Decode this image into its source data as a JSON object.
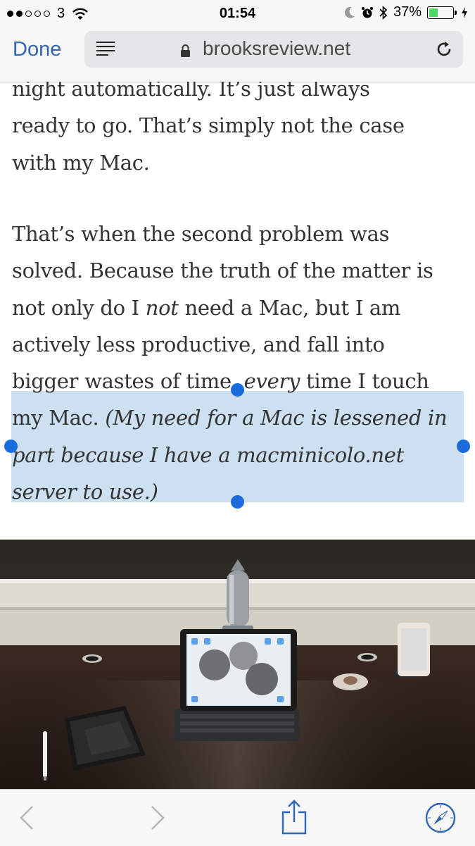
{
  "status_bar": {
    "carrier": "3",
    "time": "01:54",
    "battery": "37%",
    "battery_level": 0.37,
    "signal_bars_filled": 2,
    "signal_bars_total": 5,
    "icons": [
      "wifi-icon",
      "moon-icon",
      "alarm-icon",
      "bluetooth-icon",
      "battery-icon",
      "charging-icon"
    ]
  },
  "nav": {
    "done_label": "Done",
    "url": "brooksreview.net",
    "icons": [
      "reader-view-icon",
      "lock-icon",
      "reload-icon"
    ]
  },
  "article": {
    "p1": {
      "lines": [
        "night automatically. It’s just always",
        "ready to go. That’s simply not the case",
        "with my Mac."
      ]
    },
    "p2": {
      "l1": "That’s when the second problem was",
      "l2": "solved. Because the truth of the matter is",
      "l3_a": "not only do I ",
      "l3_em": "not",
      "l3_b": " need a Mac, but I am",
      "l4": "actively less productive, and fall into",
      "l5_a": "bigger wastes of time, ",
      "l5_em": "every",
      "l5_b": " time I touch",
      "l6_a": "my Mac. ",
      "l6_em": "(My need for a Mac is lessened in",
      "l7_em": "part because I have a macminicolo.net",
      "l8_em": "server to use.)"
    }
  },
  "colors": {
    "accent": "#2f66b3",
    "selection": "#cde0f2",
    "handle": "#1a6bdb",
    "battery_fill": "#4cd964"
  },
  "toolbar": {
    "icons": [
      "back-icon",
      "forward-icon",
      "share-icon",
      "safari-compass-icon"
    ]
  }
}
